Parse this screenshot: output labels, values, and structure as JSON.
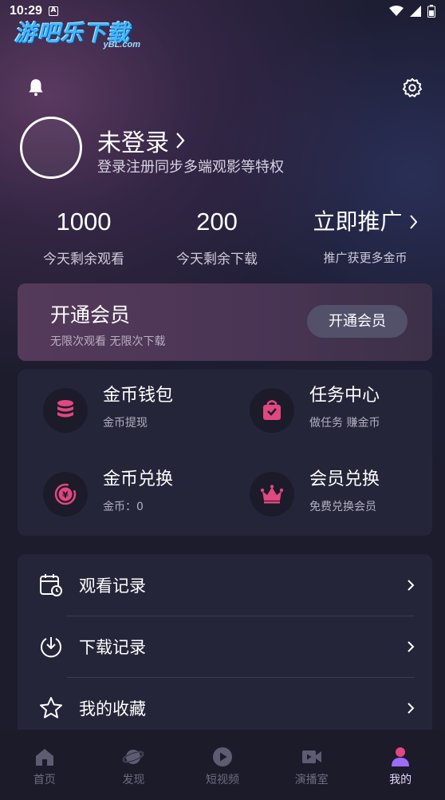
{
  "status_bar": {
    "time": "10:29",
    "notif_badge": "A"
  },
  "logo": {
    "main": "游吧乐下载",
    "sub": "yBL.com"
  },
  "profile": {
    "title": "未登录",
    "subtitle": "登录注册同步多端观影等特权"
  },
  "stats": [
    {
      "value": "1000",
      "label": "今天剩余观看"
    },
    {
      "value": "200",
      "label": "今天剩余下载"
    },
    {
      "value": "立即推广",
      "label": "推广获更多金币"
    }
  ],
  "vip": {
    "title": "开通会员",
    "subtitle": "无限次观看  无限次下载",
    "button": "开通会员"
  },
  "grid": [
    {
      "title": "金币钱包",
      "subtitle": "金币提现",
      "icon": "coins-stack-icon"
    },
    {
      "title": "任务中心",
      "subtitle": "做任务 赚金币",
      "icon": "task-bag-icon"
    },
    {
      "title": "金币兑换",
      "subtitle": "金币：0",
      "icon": "yen-exchange-icon"
    },
    {
      "title": "会员兑换",
      "subtitle": "免费兑换会员",
      "icon": "crown-icon"
    }
  ],
  "list": [
    {
      "label": "观看记录",
      "icon": "calendar-clock-icon"
    },
    {
      "label": "下载记录",
      "icon": "download-circle-icon"
    },
    {
      "label": "我的收藏",
      "icon": "star-icon"
    }
  ],
  "tabs": [
    {
      "label": "首页",
      "icon": "home-icon",
      "active": false
    },
    {
      "label": "发现",
      "icon": "planet-icon",
      "active": false
    },
    {
      "label": "短视频",
      "icon": "play-circle-icon",
      "active": false
    },
    {
      "label": "演播室",
      "icon": "video-camera-icon",
      "active": false
    },
    {
      "label": "我的",
      "icon": "user-icon",
      "active": true
    }
  ],
  "colors": {
    "accent_pink": "#e0487f",
    "tab_active": "#9b6cff",
    "card_bg": "#25253a"
  }
}
